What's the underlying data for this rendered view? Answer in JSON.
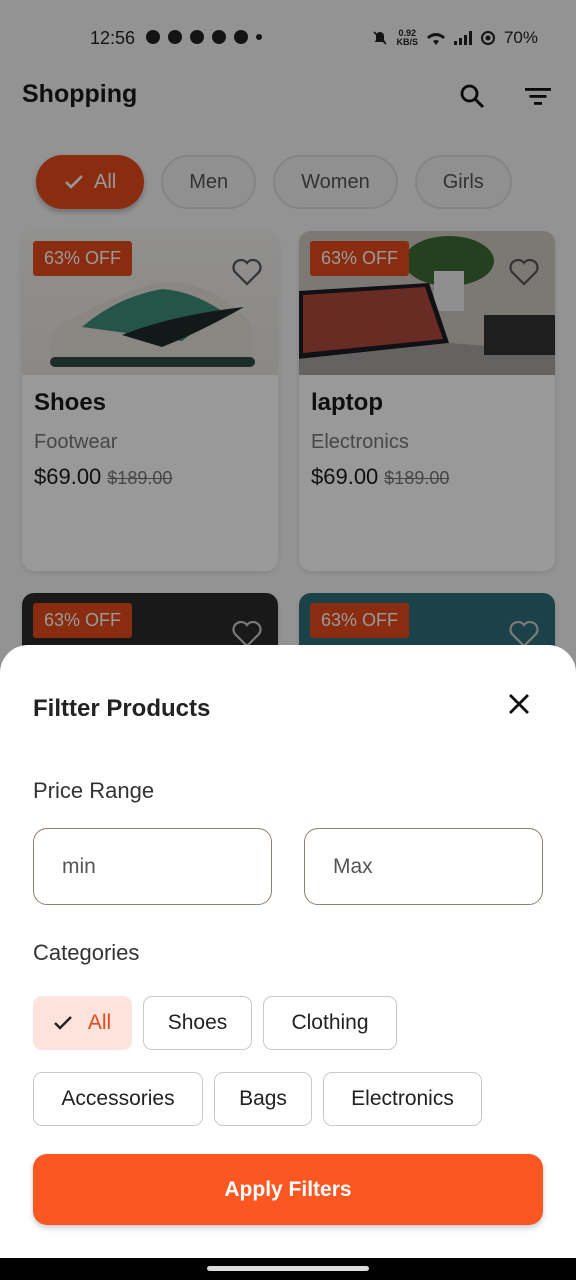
{
  "status_bar": {
    "time": "12:56",
    "speed_value": "0.92",
    "speed_unit": "KB/S",
    "battery": "70%"
  },
  "app": {
    "title": "Shopping",
    "search_icon": "search-icon",
    "filter_icon": "filter-icon"
  },
  "chips": [
    {
      "label": "All",
      "active": true
    },
    {
      "label": "Men",
      "active": false
    },
    {
      "label": "Women",
      "active": false
    },
    {
      "label": "Girls",
      "active": false
    }
  ],
  "products": [
    {
      "badge": "63% OFF",
      "name": "Shoes",
      "category": "Footwear",
      "price": "$69.00",
      "old_price": "$189.00"
    },
    {
      "badge": "63% OFF",
      "name": "laptop",
      "category": "Electronics",
      "price": "$69.00",
      "old_price": "$189.00"
    },
    {
      "badge": "63% OFF"
    },
    {
      "badge": "63% OFF"
    }
  ],
  "sheet": {
    "title": "Filtter Products",
    "price_label": "Price Range",
    "min_placeholder": "min",
    "max_placeholder": "Max",
    "categories_label": "Categories",
    "categories": [
      "All",
      "Shoes",
      "Clothing",
      "Accessories",
      "Bags",
      "Electronics"
    ],
    "apply_label": "Apply Filters"
  },
  "colors": {
    "accent": "#e64a19",
    "apply": "#fb5722",
    "selected_chip_bg": "#fde3db"
  }
}
